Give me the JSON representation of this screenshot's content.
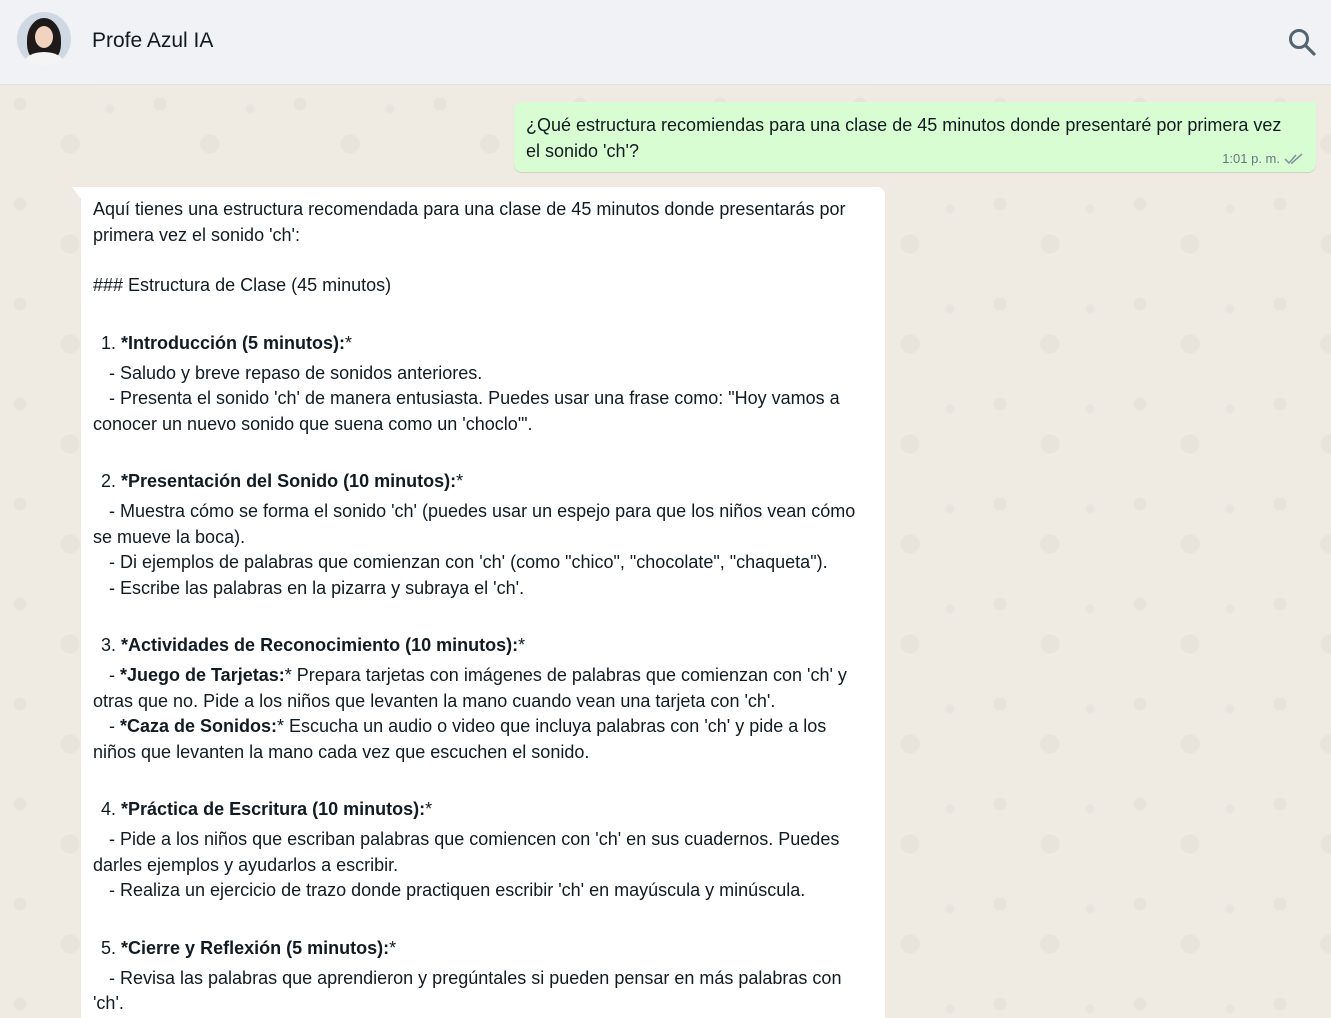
{
  "header": {
    "contact_name": "Profe Azul IA",
    "avatar_icon": "avatar-illustration",
    "search_icon": "search-icon"
  },
  "messages": {
    "outgoing": {
      "text": "¿Qué estructura recomiendas para una clase de 45 minutos donde presentaré por primera vez el sonido 'ch'?",
      "time": "1:01 p. m.",
      "status_icon": "double-check-icon"
    },
    "incoming": {
      "intro": "Aquí tienes una estructura recomendada para una clase de 45 minutos donde presentarás por primera vez el sonido 'ch':",
      "heading": "### Estructura de Clase (45 minutos)",
      "sections": [
        {
          "num": "1.",
          "title": "*Introducción (5 minutos):",
          "title_tail": "*",
          "lines": [
            {
              "bold": "",
              "text": "- Saludo y breve repaso de sonidos anteriores."
            },
            {
              "bold": "",
              "text": "- Presenta el sonido 'ch' de manera entusiasta. Puedes usar una frase como: \"Hoy vamos a conocer un nuevo sonido que suena como un 'choclo'\"."
            }
          ]
        },
        {
          "num": "2.",
          "title": "*Presentación del Sonido (10 minutos):",
          "title_tail": "*",
          "lines": [
            {
              "bold": "",
              "text": "- Muestra cómo se forma el sonido 'ch' (puedes usar un espejo para que los niños vean cómo se mueve la boca)."
            },
            {
              "bold": "",
              "text": "- Di ejemplos de palabras que comienzan con 'ch' (como \"chico\", \"chocolate\", \"chaqueta\")."
            },
            {
              "bold": "",
              "text": "- Escribe las palabras en la pizarra y subraya el 'ch'."
            }
          ]
        },
        {
          "num": "3.",
          "title": "*Actividades de Reconocimiento (10 minutos):",
          "title_tail": "*",
          "lines": [
            {
              "prefix": "- ",
              "bold": "*Juego de Tarjetas:",
              "text": "* Prepara tarjetas con imágenes de palabras que comienzan con 'ch' y otras que no. Pide a los niños que levanten la mano cuando vean una tarjeta con 'ch'."
            },
            {
              "prefix": "- ",
              "bold": "*Caza de Sonidos:",
              "text": "* Escucha un audio o video que incluya palabras con 'ch' y pide a los niños que levanten la mano cada vez que escuchen el sonido."
            }
          ]
        },
        {
          "num": "4.",
          "title": "*Práctica de Escritura (10 minutos):",
          "title_tail": "*",
          "lines": [
            {
              "bold": "",
              "text": "- Pide a los niños que escriban palabras que comiencen con 'ch' en sus cuadernos. Puedes darles ejemplos y ayudarlos a escribir."
            },
            {
              "bold": "",
              "text": "- Realiza un ejercicio de trazo donde practiquen escribir 'ch' en mayúscula y minúscula."
            }
          ]
        },
        {
          "num": "5.",
          "title": "*Cierre y Reflexión (5 minutos):",
          "title_tail": "*",
          "lines": [
            {
              "bold": "",
              "text": "- Revisa las palabras que aprendieron y pregúntales si pueden pensar en más palabras con 'ch'."
            }
          ]
        }
      ]
    }
  },
  "colors": {
    "header_bg": "#f0f2f5",
    "chat_bg": "#efeae2",
    "outgoing_bubble": "#d9fdd3",
    "incoming_bubble": "#ffffff",
    "tick_color": "#8696a0"
  }
}
